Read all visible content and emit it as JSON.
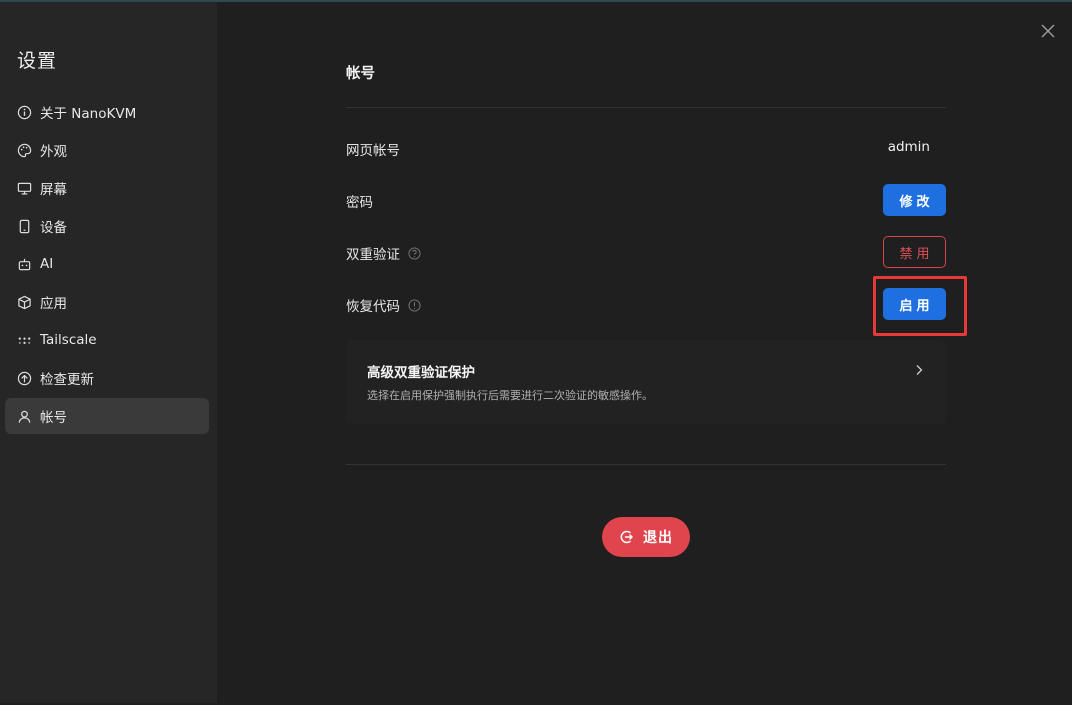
{
  "sidebar": {
    "title": "设置",
    "items": [
      {
        "label": "关于 NanoKVM",
        "icon": "info-icon"
      },
      {
        "label": "外观",
        "icon": "palette-icon"
      },
      {
        "label": "屏幕",
        "icon": "monitor-icon"
      },
      {
        "label": "设备",
        "icon": "device-icon"
      },
      {
        "label": "AI",
        "icon": "robot-icon"
      },
      {
        "label": "应用",
        "icon": "package-icon"
      },
      {
        "label": "Tailscale",
        "icon": "tailscale-icon"
      },
      {
        "label": "检查更新",
        "icon": "update-icon"
      },
      {
        "label": "帐号",
        "icon": "user-icon",
        "active": true
      }
    ]
  },
  "account": {
    "title": "帐号",
    "web_account_label": "网页帐号",
    "username": "admin",
    "password_label": "密码",
    "password_button": "修改",
    "two_factor_label": "双重验证",
    "two_factor_button": "禁用",
    "recovery_label": "恢复代码",
    "recovery_button": "启用",
    "advanced_title": "高级双重验证保护",
    "advanced_desc": "选择在启用保护强制执行后需要进行二次验证的敏感操作。",
    "logout_label": "退出"
  },
  "colors": {
    "accent_blue": "#1e6fe0",
    "danger_red": "#e0454d",
    "highlight_red": "#e8383a"
  }
}
